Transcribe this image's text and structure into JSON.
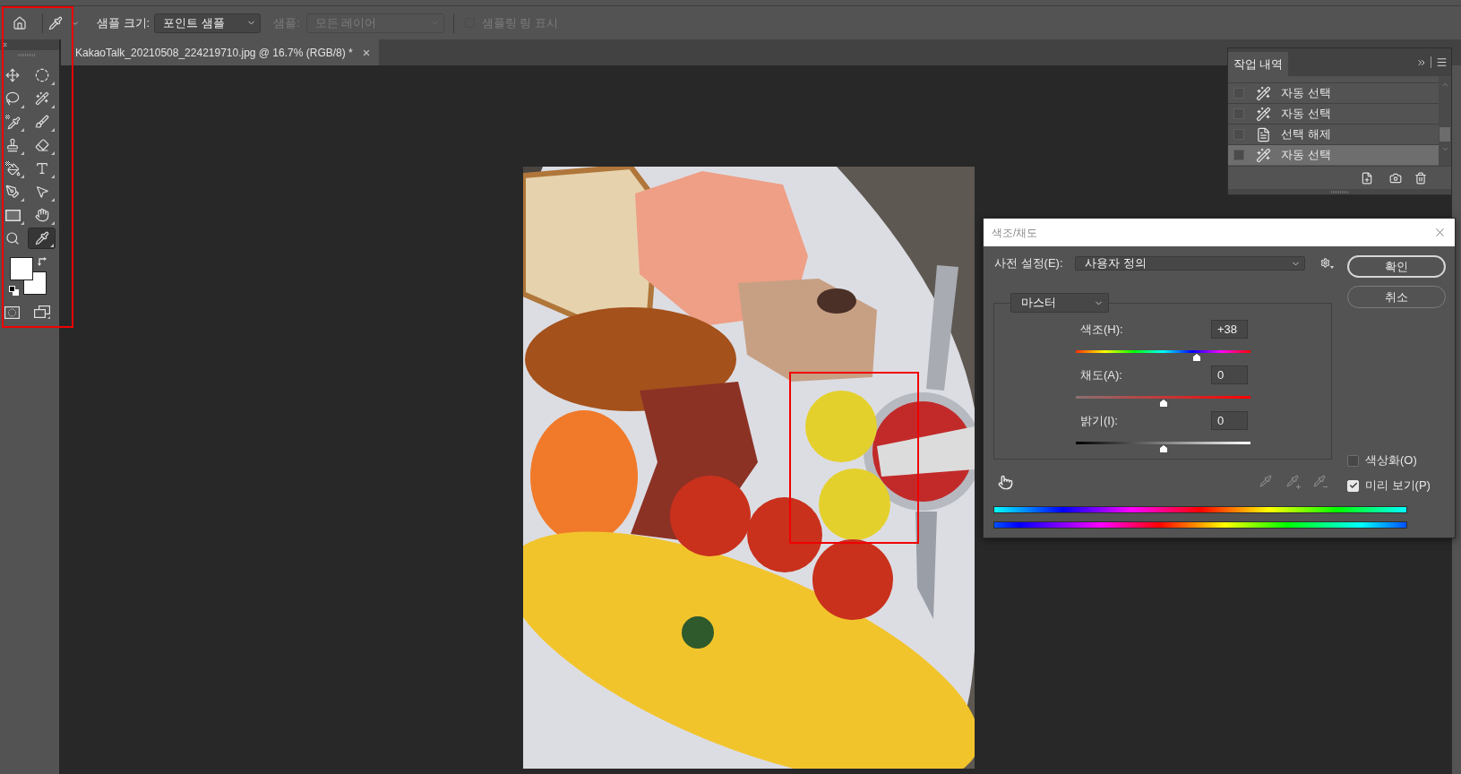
{
  "options_bar": {
    "sample_size": {
      "label": "샘플 크기:",
      "value": "포인트 샘플"
    },
    "sample": {
      "label": "샘플:",
      "value": "모든 레이어",
      "disabled": true
    },
    "sampling_ring": {
      "label": "샘플링 링 표시",
      "checked": false,
      "disabled": true
    }
  },
  "document_tab": {
    "title": "KakaoTalk_20210508_224219710.jpg @ 16.7% (RGB/8) *",
    "selected": true
  },
  "toolbar": {
    "tools": [
      {
        "kind": "move",
        "selected": false
      },
      {
        "kind": "elliptical-marquee",
        "selected": false
      },
      {
        "kind": "lasso",
        "selected": false
      },
      {
        "kind": "magic-wand",
        "selected": false
      },
      {
        "kind": "color-sampler",
        "selected": false
      },
      {
        "kind": "brush",
        "selected": false
      },
      {
        "kind": "stamp",
        "selected": false
      },
      {
        "kind": "eraser",
        "selected": false
      },
      {
        "kind": "paint-bucket",
        "selected": false
      },
      {
        "kind": "type",
        "selected": false
      },
      {
        "kind": "pen",
        "selected": false
      },
      {
        "kind": "path-selection",
        "selected": false
      },
      {
        "kind": "rectangle",
        "selected": false
      },
      {
        "kind": "hand",
        "selected": false
      },
      {
        "kind": "zoom",
        "selected": false
      },
      {
        "kind": "eyedropper",
        "selected": true
      }
    ]
  },
  "history_panel": {
    "tab": {
      "label": "작업 내역",
      "selected": true
    },
    "items": [
      {
        "kind": "magic-wand",
        "label": "자동 선택",
        "checked": false,
        "selected": false
      },
      {
        "kind": "magic-wand",
        "label": "자동 선택",
        "checked": false,
        "selected": false
      },
      {
        "kind": "deselect",
        "label": "선택 해제",
        "checked": false,
        "selected": false
      },
      {
        "kind": "magic-wand",
        "label": "자동 선택",
        "checked": false,
        "selected": true
      }
    ]
  },
  "dialog": {
    "title": "색조/채도",
    "preset": {
      "label": "사전 설정(E):",
      "value": "사용자 정의"
    },
    "buttons": [
      {
        "label": "확인",
        "default": true
      },
      {
        "label": "취소",
        "default": false
      }
    ],
    "channel": "마스터",
    "sliders": [
      {
        "kind": "hue",
        "label": "색조(H):",
        "value": "+38",
        "level": 0.69
      },
      {
        "kind": "saturation",
        "label": "채도(A):",
        "value": "0",
        "level": 0.5
      },
      {
        "kind": "lightness",
        "label": "밝기(I):",
        "value": "0",
        "level": 0.5
      }
    ],
    "eyedroppers": [
      {
        "kind": "sample",
        "disabled": true
      },
      {
        "kind": "add",
        "disabled": true
      },
      {
        "kind": "subtract",
        "disabled": true
      }
    ],
    "options": [
      {
        "label": "색상화(O)",
        "checked": false
      },
      {
        "label": "미리 보기(P)",
        "checked": true
      }
    ]
  }
}
